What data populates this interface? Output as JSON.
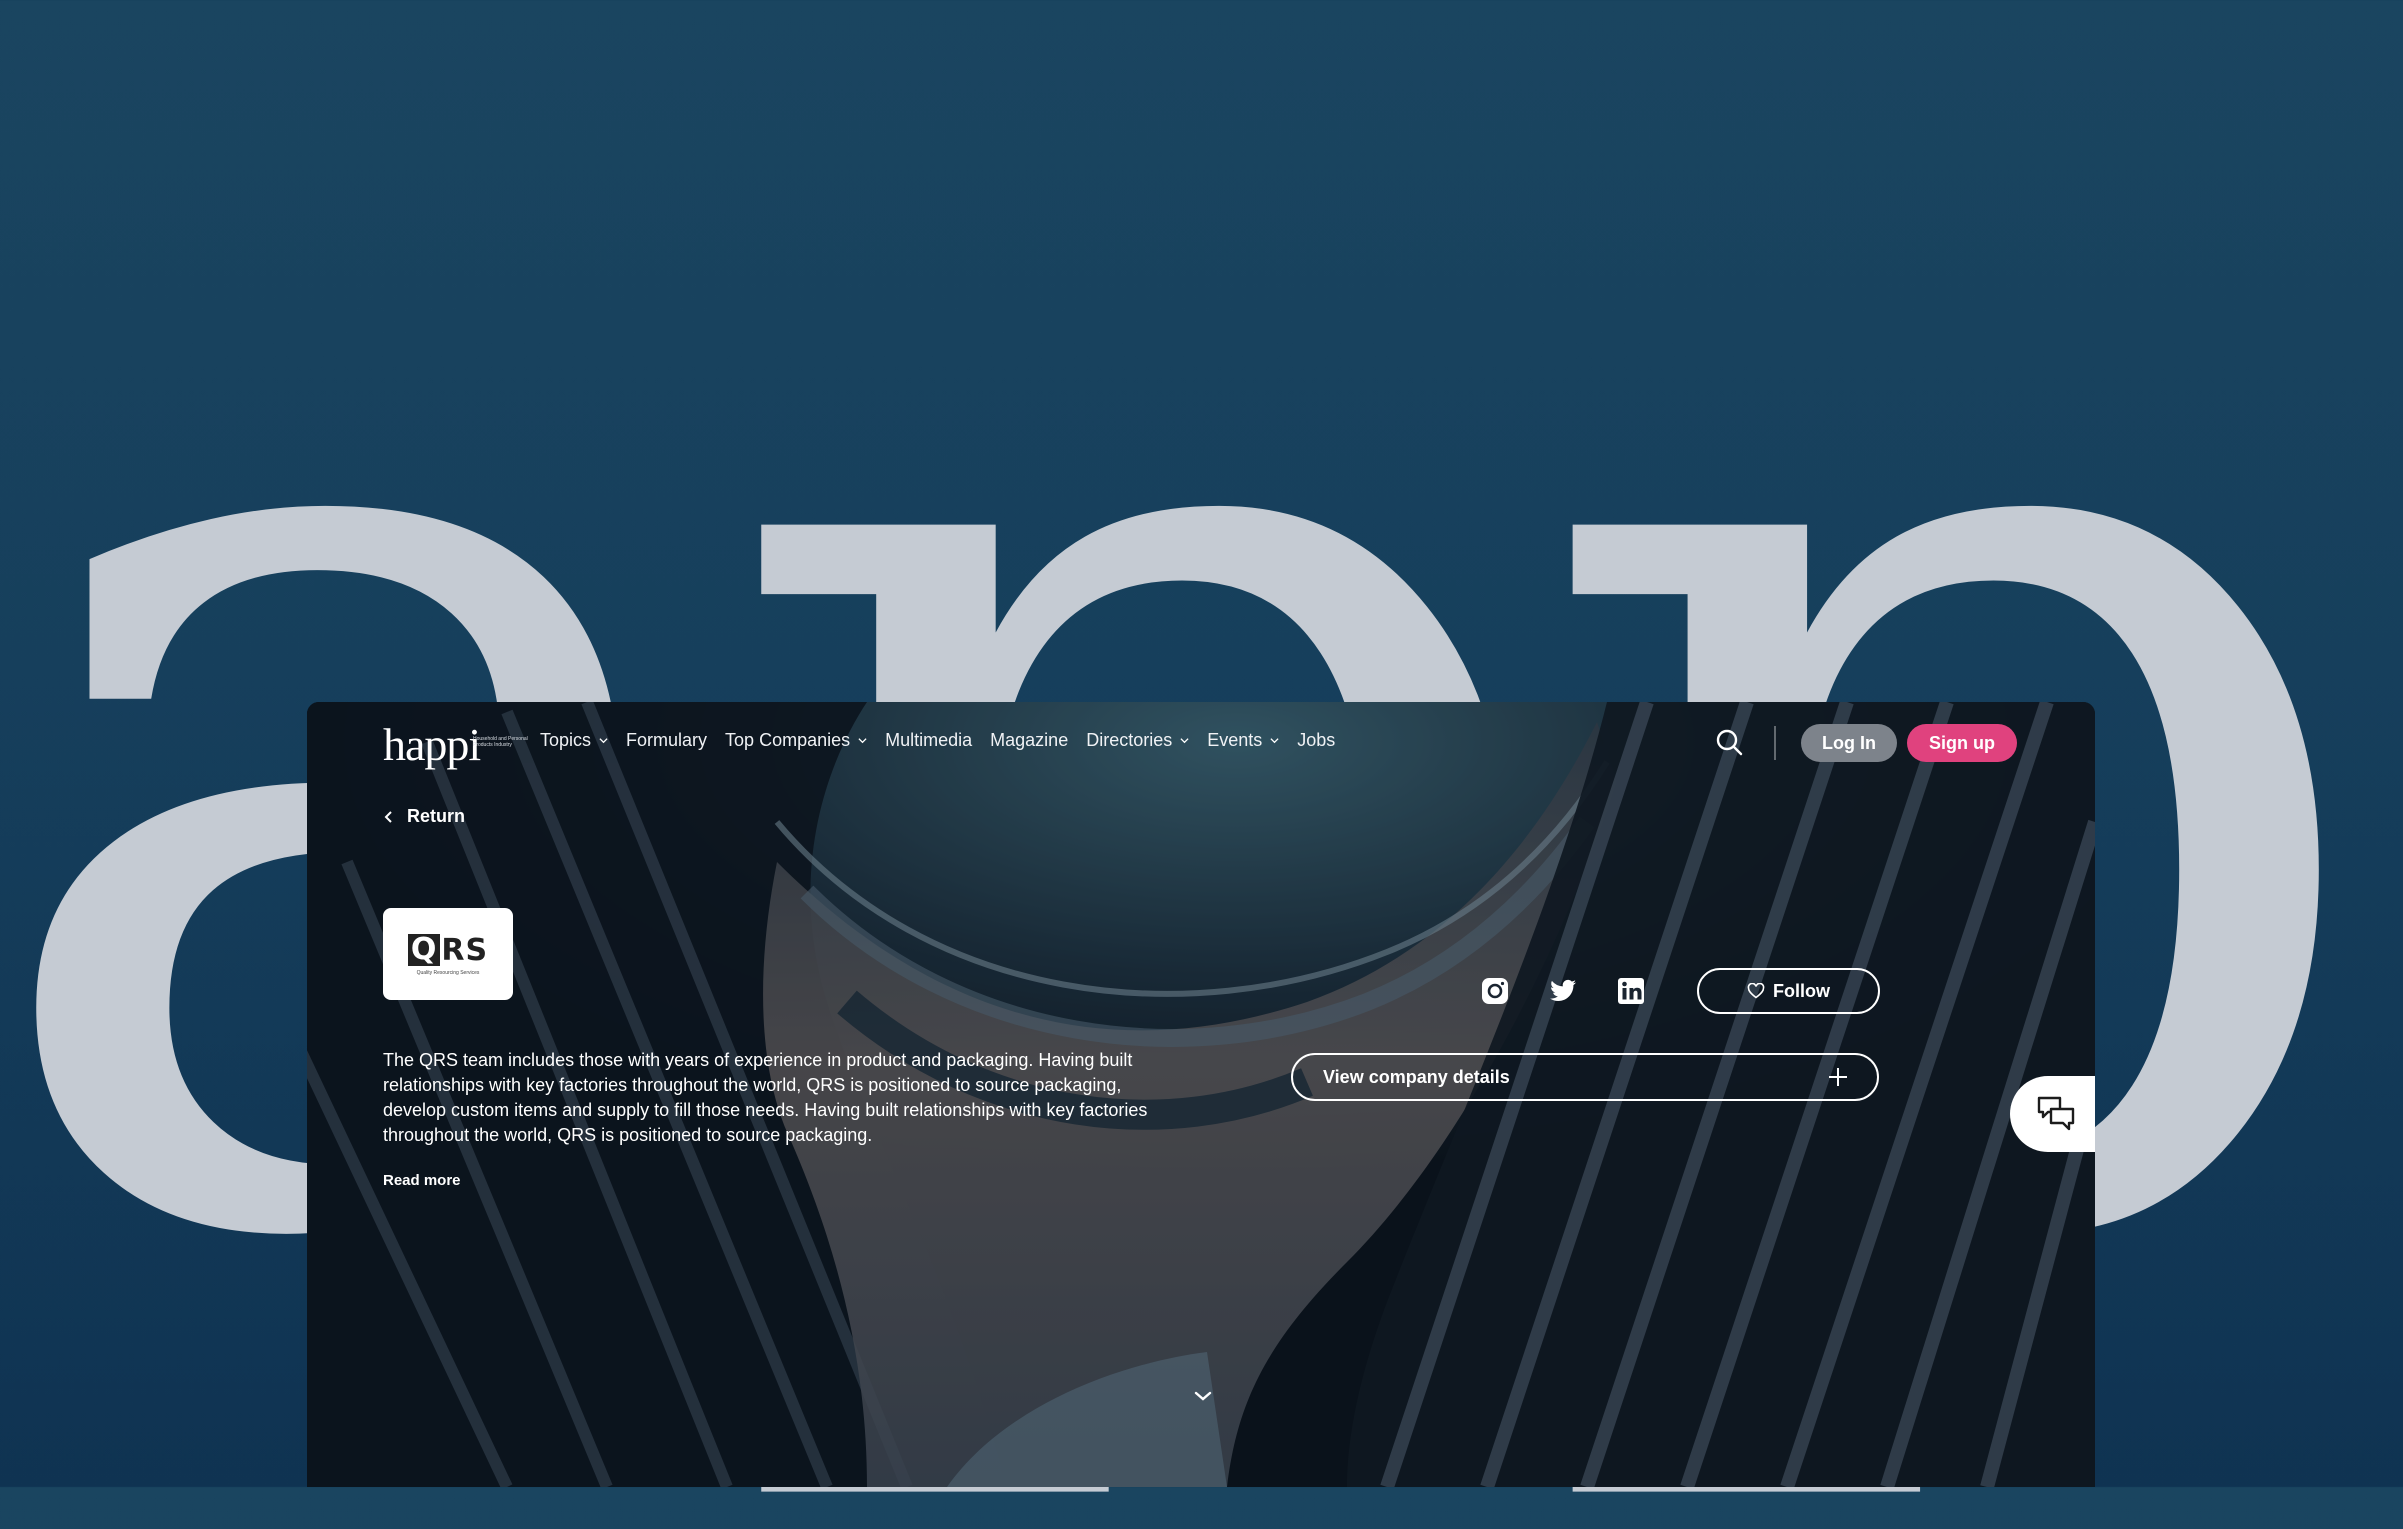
{
  "background": {
    "word": "app"
  },
  "nav": {
    "logo": "happi",
    "logo_tagline": "Household and Personal Products Industry",
    "items": [
      {
        "label": "Topics",
        "dropdown": true
      },
      {
        "label": "Formulary",
        "dropdown": false
      },
      {
        "label": "Top Companies",
        "dropdown": true
      },
      {
        "label": "Multimedia",
        "dropdown": false
      },
      {
        "label": "Magazine",
        "dropdown": false
      },
      {
        "label": "Directories",
        "dropdown": true
      },
      {
        "label": "Events",
        "dropdown": true
      },
      {
        "label": "Jobs",
        "dropdown": false
      }
    ],
    "login_label": "Log In",
    "signup_label": "Sign up"
  },
  "return_label": "Return",
  "company": {
    "logo_text": "RS",
    "logo_q": "Q",
    "logo_tagline": "Quality Resourcing Services",
    "description": "The QRS team includes those with years of experience in product and packaging. Having built relationships with key factories throughout the world, QRS is positioned to source packaging, develop custom items and supply to fill those needs. Having built relationships with key factories throughout the world, QRS is positioned to source packaging.",
    "read_more_label": "Read more",
    "follow_label": "Follow",
    "details_label": "View company details"
  },
  "social_icons": [
    "instagram-icon",
    "twitter-icon",
    "linkedin-icon"
  ],
  "colors": {
    "accent_pink": "#e0427e",
    "login_gray": "#7d838b",
    "background_navy": "#163f5c",
    "letter_gray": "#c5cbd3"
  }
}
